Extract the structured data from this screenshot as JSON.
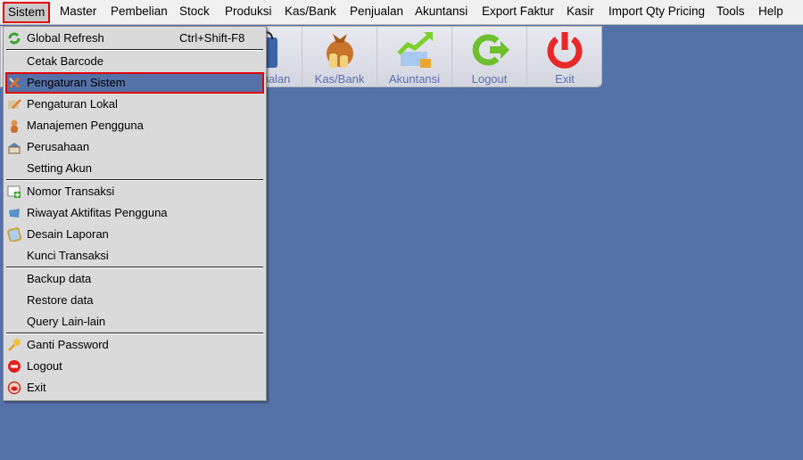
{
  "menubar": {
    "items": [
      "Sistem",
      "Master",
      "Pembelian",
      "Stock",
      "Produksi",
      "Kas/Bank",
      "Penjualan",
      "Akuntansi",
      "Export Faktur",
      "Kasir",
      "Import Qty Pricing",
      "Tools",
      "Help"
    ],
    "active": "Sistem"
  },
  "toolbar": {
    "buttons": [
      {
        "label": "Penjualan",
        "icon": "shopping-bag-icon"
      },
      {
        "label": "Kas/Bank",
        "icon": "money-bag-icon"
      },
      {
        "label": "Akuntansi",
        "icon": "growth-chart-icon"
      },
      {
        "label": "Logout",
        "icon": "logout-arrow-icon"
      },
      {
        "label": "Exit",
        "icon": "power-icon"
      }
    ]
  },
  "menu": {
    "global_refresh": {
      "label": "Global Refresh",
      "shortcut": "Ctrl+Shift-F8",
      "icon": "refresh-icon"
    },
    "cetak_barcode": "Cetak Barcode",
    "pengaturan_sistem": "Pengaturan Sistem",
    "pengaturan_lokal": "Pengaturan Lokal",
    "manajemen_pengguna": "Manajemen Pengguna",
    "perusahaan": "Perusahaan",
    "setting_akun": "Setting Akun",
    "nomor_transaksi": "Nomor Transaksi",
    "riwayat": "Riwayat Aktifitas Pengguna",
    "desain_laporan": "Desain Laporan",
    "kunci_transaksi": "Kunci Transaksi",
    "backup": "Backup data",
    "restore": "Restore data",
    "query": "Query Lain-lain",
    "ganti_password": "Ganti Password",
    "logout": "Logout",
    "exit": "Exit"
  },
  "colors": {
    "desktop": "#5572a8",
    "highlight": "#5572a8",
    "annotation": "#e00000"
  }
}
